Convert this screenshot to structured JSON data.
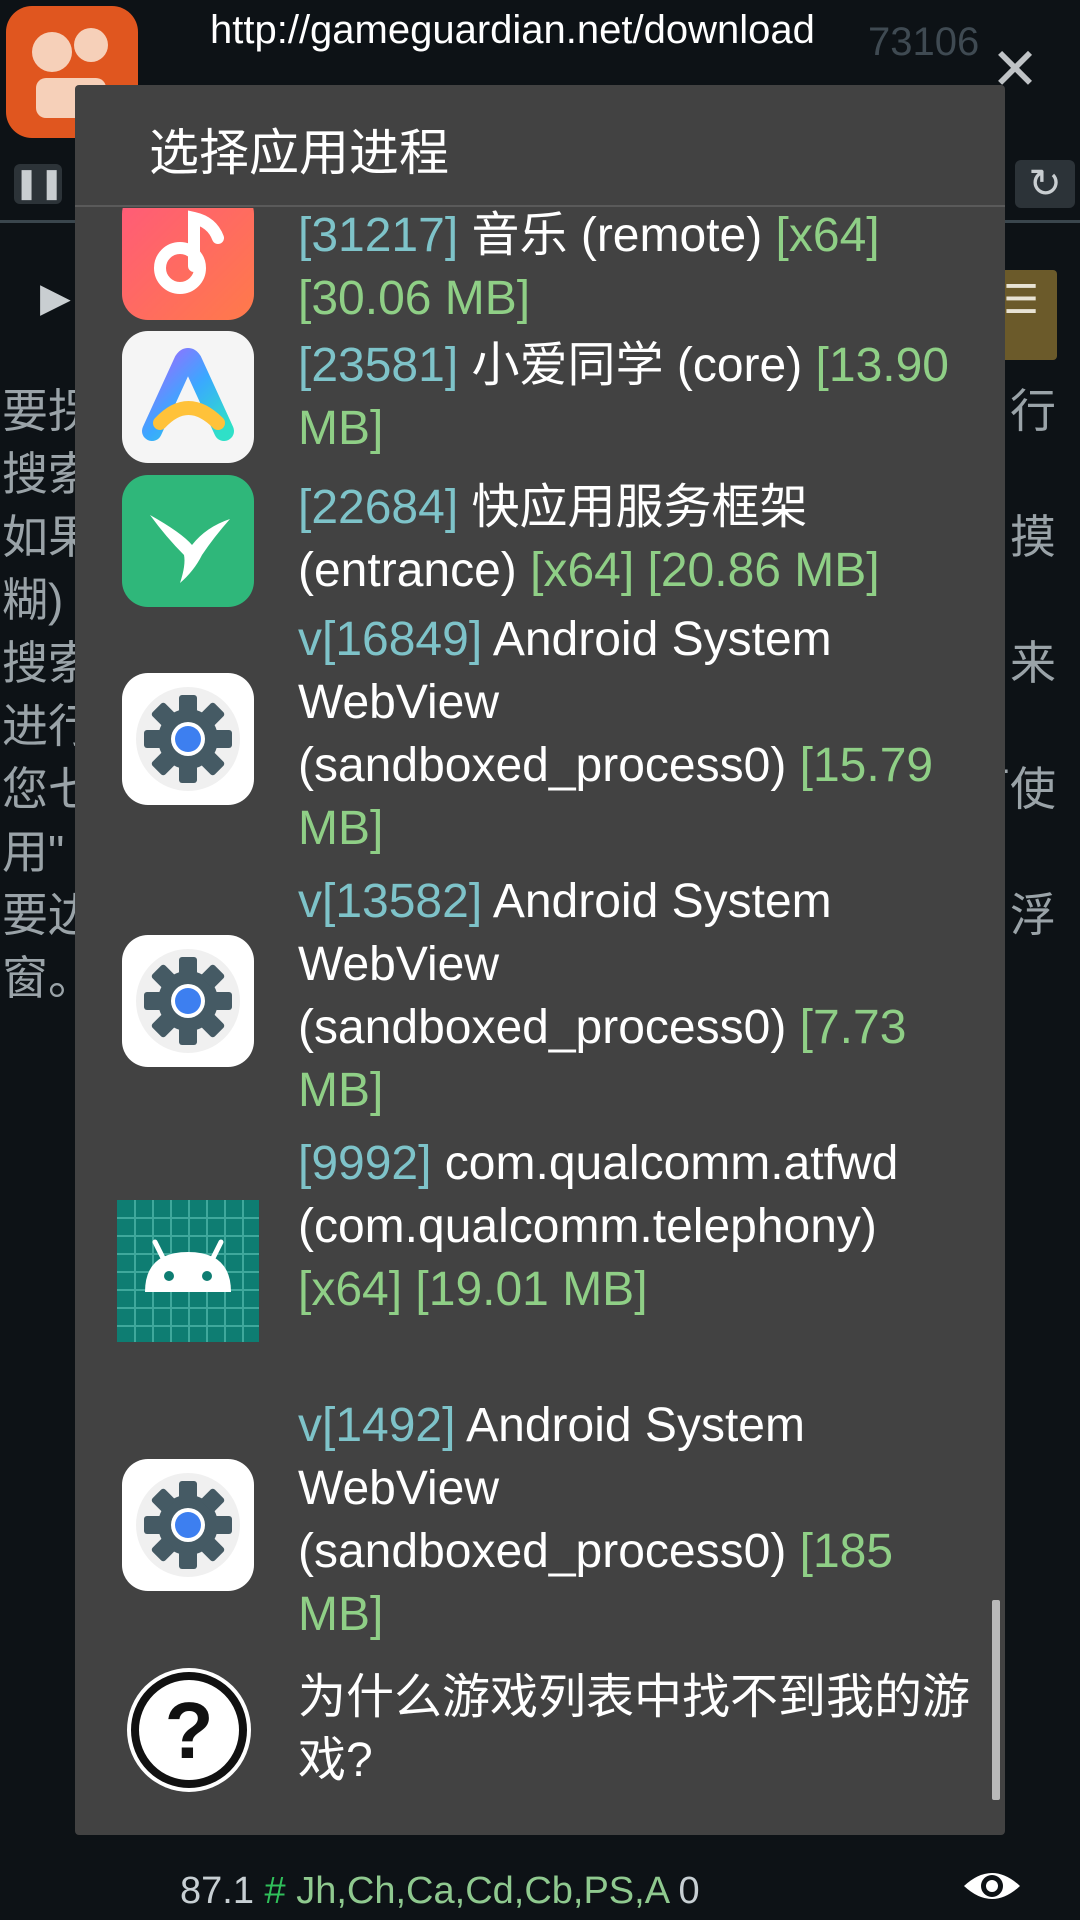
{
  "background": {
    "url": "http://gameguardian.net/download",
    "partial_number": "73106",
    "left_text_fragments": [
      "要拐",
      "搜索",
      "如果",
      "糊)",
      "搜索",
      "进行",
      "您七",
      "用\"",
      "要边",
      "窗。"
    ],
    "right_text_fragments": [
      "行",
      "摸",
      "来",
      "可使",
      "浮"
    ],
    "status_bar": {
      "value": "87.1",
      "hash": "#",
      "flags": "Jh,Ch,Ca,Cd,Cb,PS,A",
      "count": "0"
    },
    "icons": [
      "app-logo-icon",
      "close-icon",
      "pause-icon",
      "refresh-icon",
      "play-icon",
      "menu-icon",
      "eye-icon"
    ]
  },
  "dialog": {
    "title": "选择应用进程",
    "processes": [
      {
        "pid": "[31217]",
        "name": "音乐 (remote)",
        "arch": "[x64]",
        "size": "[30.06 MB]",
        "icon": "music-icon"
      },
      {
        "pid": "[23581]",
        "name": "小爱同学 (core)",
        "arch": "",
        "size": "[13.90 MB]",
        "icon": "xiaoai-icon"
      },
      {
        "pid": "[22684]",
        "name": "快应用服务框架 (entrance)",
        "arch": "[x64]",
        "size": "[20.86 MB]",
        "icon": "quickapp-icon"
      },
      {
        "pid": "v[16849]",
        "name": "Android System WebView (sandboxed_process0)",
        "arch": "",
        "size": "[15.79 MB]",
        "icon": "webview-gear-icon"
      },
      {
        "pid": "v[13582]",
        "name": "Android System WebView (sandboxed_process0)",
        "arch": "",
        "size": "[7.73 MB]",
        "icon": "webview-gear-icon"
      },
      {
        "pid": "[9992]",
        "name": "com.qualcomm.atfwd (com.qualcomm.telephony)",
        "arch": "[x64]",
        "size": "[19.01 MB]",
        "icon": "android-icon"
      },
      {
        "pid": "v[1492]",
        "name": "Android System WebView (sandboxed_process0)",
        "arch": "",
        "size": "[185 MB]",
        "icon": "webview-gear-icon"
      }
    ],
    "help_item": {
      "label": "为什么游戏列表中找不到我的游戏?",
      "icon": "question-icon"
    }
  }
}
